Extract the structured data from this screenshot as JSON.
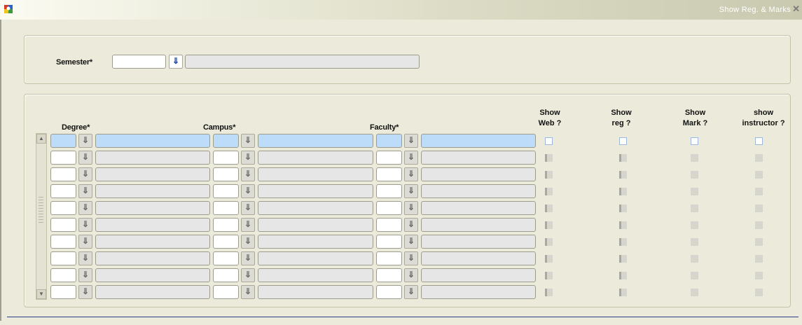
{
  "window": {
    "title": "Show Reg. & Marks",
    "close_glyph": "✕"
  },
  "top": {
    "semester_label": "Semester*",
    "semester_code": "",
    "semester_desc": ""
  },
  "grid": {
    "headers": {
      "degree": "Degree*",
      "campus": "Campus*",
      "faculty": "Faculty*",
      "show_web": [
        "Show",
        "Web ?"
      ],
      "show_reg": [
        "Show",
        "reg ?"
      ],
      "show_mark": [
        "Show",
        "Mark ?"
      ],
      "show_instructor": [
        "show",
        "instructor ?"
      ]
    },
    "lov_glyph": "⇓",
    "rows": [
      {
        "selected": true,
        "degree_code": "",
        "degree_desc": "",
        "campus_code": "",
        "campus_desc": "",
        "faculty_code": "",
        "faculty_desc": "",
        "show_web": false,
        "show_reg": false,
        "show_mark": false,
        "show_instructor": false
      },
      {
        "selected": false,
        "degree_code": "",
        "degree_desc": "",
        "campus_code": "",
        "campus_desc": "",
        "faculty_code": "",
        "faculty_desc": "",
        "show_web": false,
        "show_reg": false,
        "show_mark": false,
        "show_instructor": false
      },
      {
        "selected": false,
        "degree_code": "",
        "degree_desc": "",
        "campus_code": "",
        "campus_desc": "",
        "faculty_code": "",
        "faculty_desc": "",
        "show_web": false,
        "show_reg": false,
        "show_mark": false,
        "show_instructor": false
      },
      {
        "selected": false,
        "degree_code": "",
        "degree_desc": "",
        "campus_code": "",
        "campus_desc": "",
        "faculty_code": "",
        "faculty_desc": "",
        "show_web": false,
        "show_reg": false,
        "show_mark": false,
        "show_instructor": false
      },
      {
        "selected": false,
        "degree_code": "",
        "degree_desc": "",
        "campus_code": "",
        "campus_desc": "",
        "faculty_code": "",
        "faculty_desc": "",
        "show_web": false,
        "show_reg": false,
        "show_mark": false,
        "show_instructor": false
      },
      {
        "selected": false,
        "degree_code": "",
        "degree_desc": "",
        "campus_code": "",
        "campus_desc": "",
        "faculty_code": "",
        "faculty_desc": "",
        "show_web": false,
        "show_reg": false,
        "show_mark": false,
        "show_instructor": false
      },
      {
        "selected": false,
        "degree_code": "",
        "degree_desc": "",
        "campus_code": "",
        "campus_desc": "",
        "faculty_code": "",
        "faculty_desc": "",
        "show_web": false,
        "show_reg": false,
        "show_mark": false,
        "show_instructor": false
      },
      {
        "selected": false,
        "degree_code": "",
        "degree_desc": "",
        "campus_code": "",
        "campus_desc": "",
        "faculty_code": "",
        "faculty_desc": "",
        "show_web": false,
        "show_reg": false,
        "show_mark": false,
        "show_instructor": false
      },
      {
        "selected": false,
        "degree_code": "",
        "degree_desc": "",
        "campus_code": "",
        "campus_desc": "",
        "faculty_code": "",
        "faculty_desc": "",
        "show_web": false,
        "show_reg": false,
        "show_mark": false,
        "show_instructor": false
      },
      {
        "selected": false,
        "degree_code": "",
        "degree_desc": "",
        "campus_code": "",
        "campus_desc": "",
        "faculty_code": "",
        "faculty_desc": "",
        "show_web": false,
        "show_reg": false,
        "show_mark": false,
        "show_instructor": false
      }
    ]
  }
}
